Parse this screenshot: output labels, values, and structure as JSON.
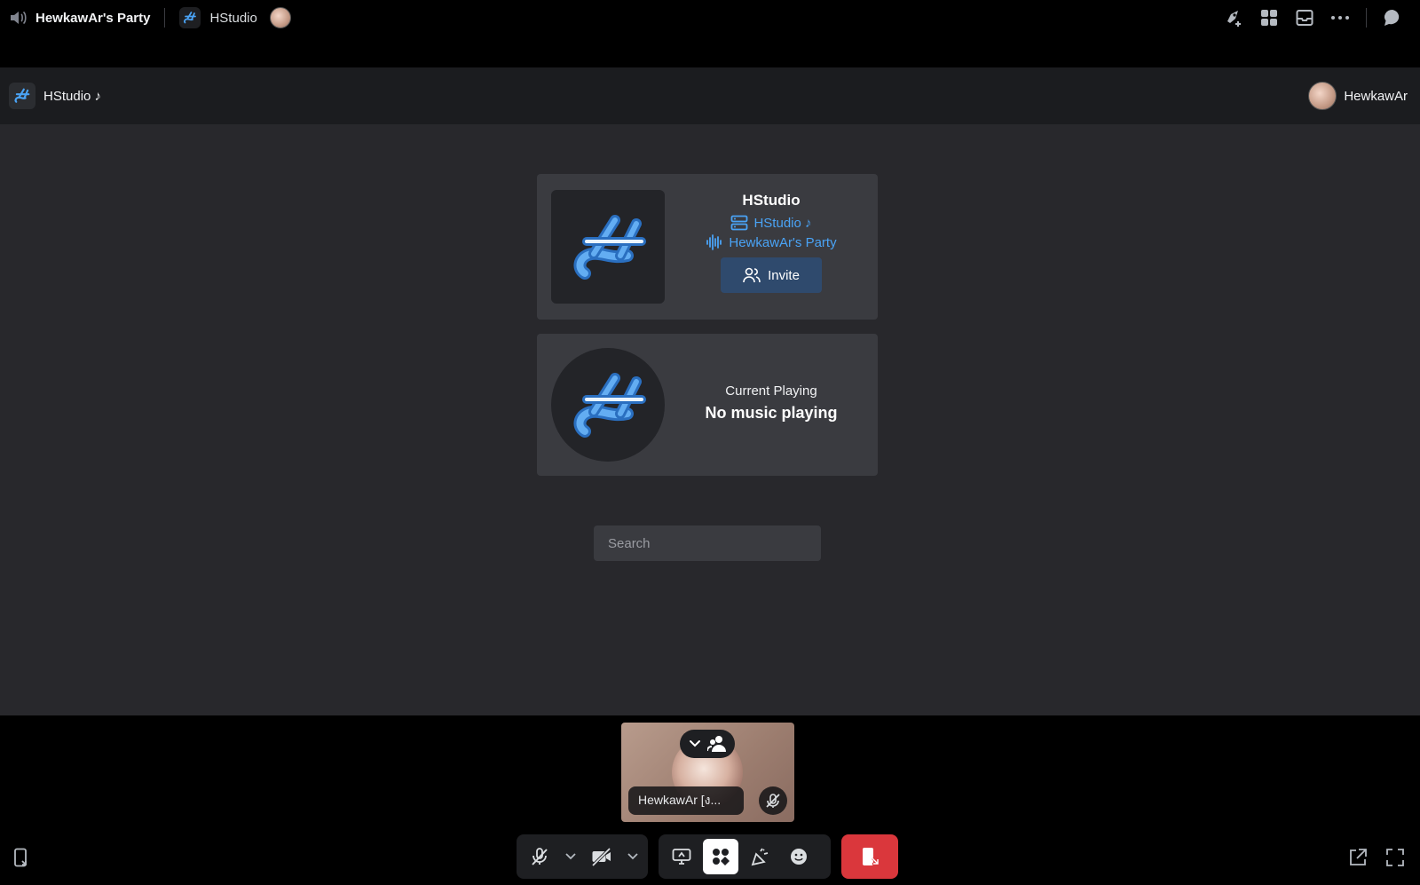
{
  "topbar": {
    "channel_title": "HewkawAr's Party",
    "app_name": "HStudio"
  },
  "activity_header": {
    "title": "HStudio ♪",
    "username": "HewkawAr"
  },
  "info_card": {
    "title": "HStudio",
    "server_link": "HStudio ♪",
    "channel_link": "HewkawAr's Party",
    "invite_label": "Invite"
  },
  "player_card": {
    "label": "Current Playing",
    "status": "No music playing"
  },
  "search": {
    "placeholder": "Search"
  },
  "participant": {
    "name": "HewkawAr [ง..."
  },
  "colors": {
    "accent_blue": "#4aa3f5",
    "invite_bg": "#2f4a6d",
    "leave_red": "#da373c"
  }
}
